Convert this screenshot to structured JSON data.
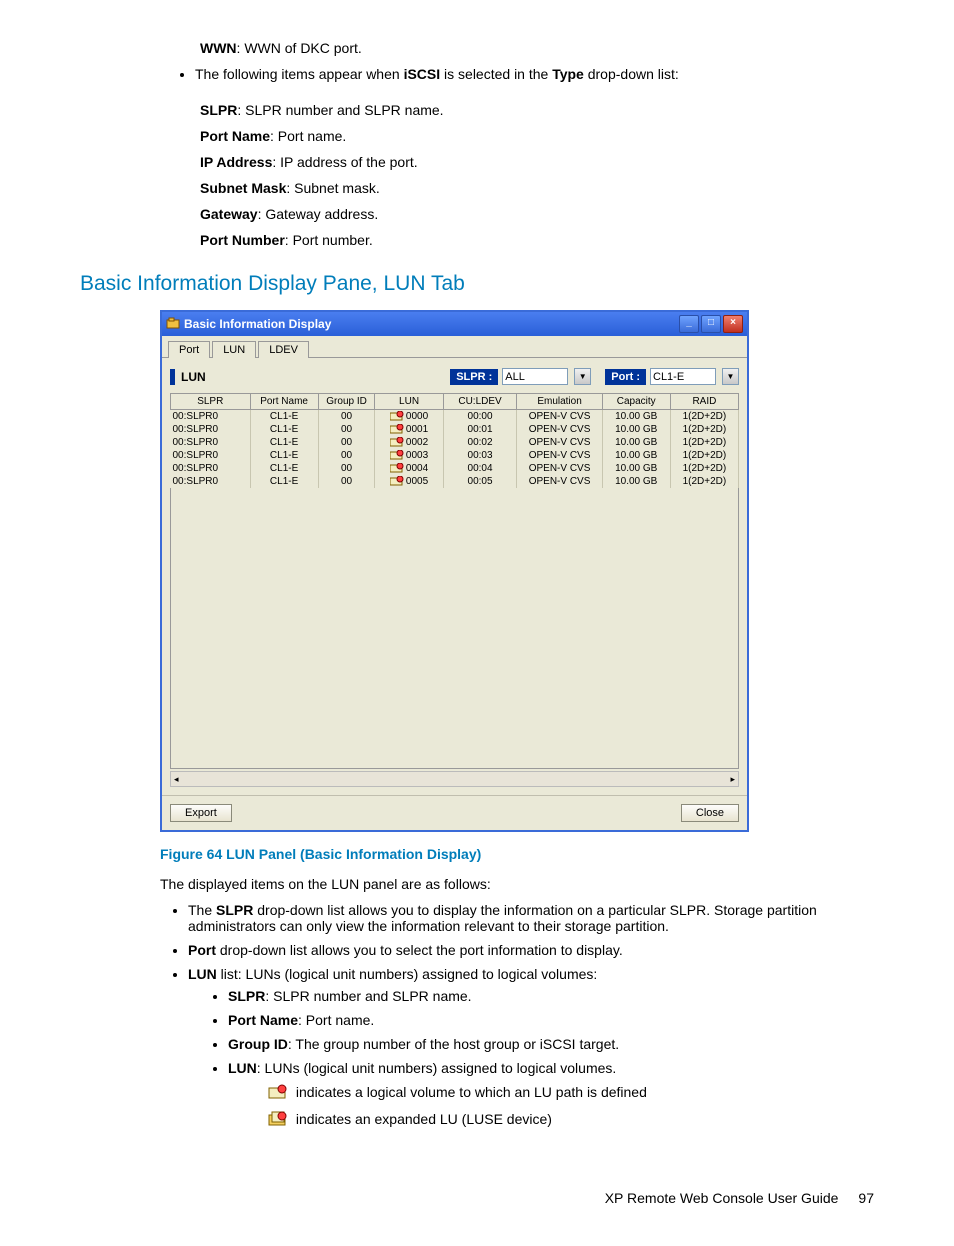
{
  "top": {
    "wwn_label": "WWN",
    "wwn_desc": ": WWN of DKC port.",
    "bullet_pre": "The following items appear when ",
    "bullet_mid": "iSCSI",
    "bullet_mid2": " is selected in the ",
    "bullet_mid3": "Type",
    "bullet_post": " drop-down list:",
    "defs": [
      {
        "term": "SLPR",
        "desc": ": SLPR number and SLPR name."
      },
      {
        "term": "Port Name",
        "desc": ": Port name."
      },
      {
        "term": "IP Address",
        "desc": ": IP address of the port."
      },
      {
        "term": "Subnet Mask",
        "desc": ": Subnet mask."
      },
      {
        "term": "Gateway",
        "desc": ": Gateway address."
      },
      {
        "term": "Port Number",
        "desc": ": Port number."
      }
    ]
  },
  "section_heading": "Basic Information Display Pane, LUN Tab",
  "window": {
    "title": "Basic Information Display",
    "tabs": [
      "Port",
      "LUN",
      "LDEV"
    ],
    "active_tab": 1,
    "panel_label": "LUN",
    "slpr_label": "SLPR :",
    "slpr_value": "ALL",
    "port_label": "Port :",
    "port_value": "CL1-E",
    "headers": [
      "SLPR",
      "Port Name",
      "Group ID",
      "LUN",
      "CU:LDEV",
      "Emulation",
      "Capacity",
      "RAID"
    ],
    "rows": [
      {
        "slpr": "00:SLPR0",
        "port": "CL1-E",
        "gid": "00",
        "lun": "0000",
        "culdev": "00:00",
        "emu": "OPEN-V CVS",
        "cap": "10.00 GB",
        "raid": "1(2D+2D)"
      },
      {
        "slpr": "00:SLPR0",
        "port": "CL1-E",
        "gid": "00",
        "lun": "0001",
        "culdev": "00:01",
        "emu": "OPEN-V CVS",
        "cap": "10.00 GB",
        "raid": "1(2D+2D)"
      },
      {
        "slpr": "00:SLPR0",
        "port": "CL1-E",
        "gid": "00",
        "lun": "0002",
        "culdev": "00:02",
        "emu": "OPEN-V CVS",
        "cap": "10.00 GB",
        "raid": "1(2D+2D)"
      },
      {
        "slpr": "00:SLPR0",
        "port": "CL1-E",
        "gid": "00",
        "lun": "0003",
        "culdev": "00:03",
        "emu": "OPEN-V CVS",
        "cap": "10.00 GB",
        "raid": "1(2D+2D)"
      },
      {
        "slpr": "00:SLPR0",
        "port": "CL1-E",
        "gid": "00",
        "lun": "0004",
        "culdev": "00:04",
        "emu": "OPEN-V CVS",
        "cap": "10.00 GB",
        "raid": "1(2D+2D)"
      },
      {
        "slpr": "00:SLPR0",
        "port": "CL1-E",
        "gid": "00",
        "lun": "0005",
        "culdev": "00:05",
        "emu": "OPEN-V CVS",
        "cap": "10.00 GB",
        "raid": "1(2D+2D)"
      }
    ],
    "export": "Export",
    "close": "Close"
  },
  "figcap": "Figure 64 LUN Panel (Basic Information Display)",
  "after_fig": "The displayed items on the LUN panel are as follows:",
  "bullets": {
    "b1a": "The ",
    "b1b": "SLPR",
    "b1c": " drop-down list allows you to display the information on a particular SLPR. Storage partition administrators can only view the information relevant to their storage partition.",
    "b2a": "Port",
    "b2b": " drop-down list allows you to select the port information to display.",
    "b3a": "LUN",
    "b3b": " list: LUNs (logical unit numbers) assigned to logical volumes:",
    "s1a": "SLPR",
    "s1b": ": SLPR number and SLPR name.",
    "s2a": "Port Name",
    "s2b": ": Port name.",
    "s3a": "Group ID",
    "s3b": ": The group number of the host group or iSCSI target.",
    "s4a": "LUN",
    "s4b": ": LUNs (logical unit numbers) assigned to logical volumes.",
    "icon1": " indicates a logical volume to which an LU path is defined",
    "icon2": " indicates an expanded LU (LUSE device)"
  },
  "footer": {
    "title": "XP Remote Web Console User Guide",
    "page": "97"
  }
}
